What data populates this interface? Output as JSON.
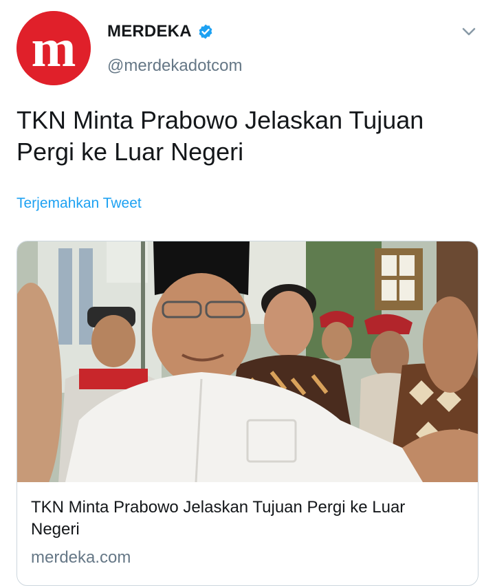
{
  "account": {
    "display_name": "MERDEKA",
    "handle": "@merdekadotcom",
    "avatar_letter": "m",
    "avatar_color": "#e0202a",
    "verified": true,
    "verified_color": "#1da1f2"
  },
  "tweet": {
    "text": "TKN Minta Prabowo Jelaskan Tujuan Pergi ke Luar Negeri",
    "translate_label": "Terjemahkan Tweet"
  },
  "card": {
    "image_description_icon": "photo",
    "title": "TKN Minta Prabowo Jelaskan Tujuan Pergi ke Luar Negeri",
    "domain": "merdeka.com"
  },
  "icons": {
    "menu": "chevron-down-icon",
    "verified": "verified-badge-icon"
  },
  "colors": {
    "text_primary": "#14171a",
    "text_secondary": "#657786",
    "link": "#1da1f2",
    "border": "#ccd6dd"
  }
}
